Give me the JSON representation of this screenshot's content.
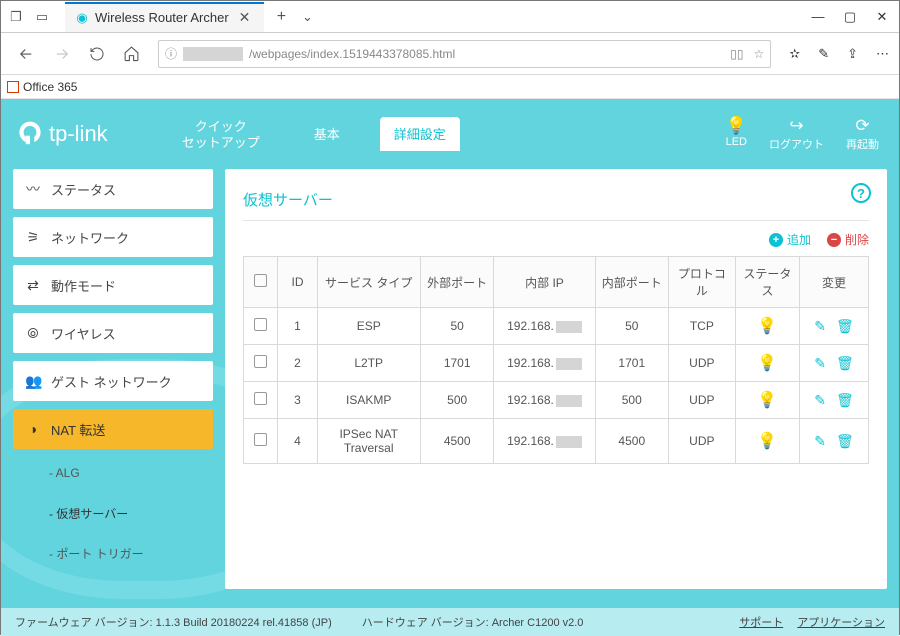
{
  "browser": {
    "tab_title": "Wireless Router Archer",
    "url_path": "/webpages/index.1519443378085.html",
    "office_label": "Office 365"
  },
  "header": {
    "brand": "tp-link",
    "tabs": {
      "quick_setup_l1": "クイック",
      "quick_setup_l2": "セットアップ",
      "basic": "基本",
      "advanced": "詳細設定"
    },
    "right": {
      "led": "LED",
      "logout": "ログアウト",
      "reboot": "再起動"
    }
  },
  "sidebar": {
    "items": [
      {
        "label": "ステータス"
      },
      {
        "label": "ネットワーク"
      },
      {
        "label": "動作モード"
      },
      {
        "label": "ワイヤレス"
      },
      {
        "label": "ゲスト ネットワーク"
      },
      {
        "label": "NAT 転送"
      }
    ],
    "sub": {
      "alg": "- ALG",
      "vserver": "- 仮想サーバー",
      "porttrig": "- ポート トリガー"
    }
  },
  "panel": {
    "title": "仮想サーバー",
    "add": "追加",
    "delete": "削除"
  },
  "table": {
    "headers": {
      "id": "ID",
      "service_type": "サービス タイプ",
      "ext_port": "外部ポート",
      "int_ip": "内部 IP",
      "int_port": "内部ポート",
      "protocol": "プロトコル",
      "status": "ステータス",
      "change": "変更"
    },
    "rows": [
      {
        "id": "1",
        "service": "ESP",
        "ext": "50",
        "ip": "192.168.",
        "intp": "50",
        "proto": "TCP"
      },
      {
        "id": "2",
        "service": "L2TP",
        "ext": "1701",
        "ip": "192.168.",
        "intp": "1701",
        "proto": "UDP"
      },
      {
        "id": "3",
        "service": "ISAKMP",
        "ext": "500",
        "ip": "192.168.",
        "intp": "500",
        "proto": "UDP"
      },
      {
        "id": "4",
        "service": "IPSec NAT Traversal",
        "ext": "4500",
        "ip": "192.168.",
        "intp": "4500",
        "proto": "UDP"
      }
    ]
  },
  "footer": {
    "fw": "ファームウェア バージョン: 1.1.3 Build 20180224 rel.41858 (JP)",
    "hw": "ハードウェア バージョン: Archer C1200 v2.0",
    "support": "サポート",
    "app": "アプリケーション"
  }
}
